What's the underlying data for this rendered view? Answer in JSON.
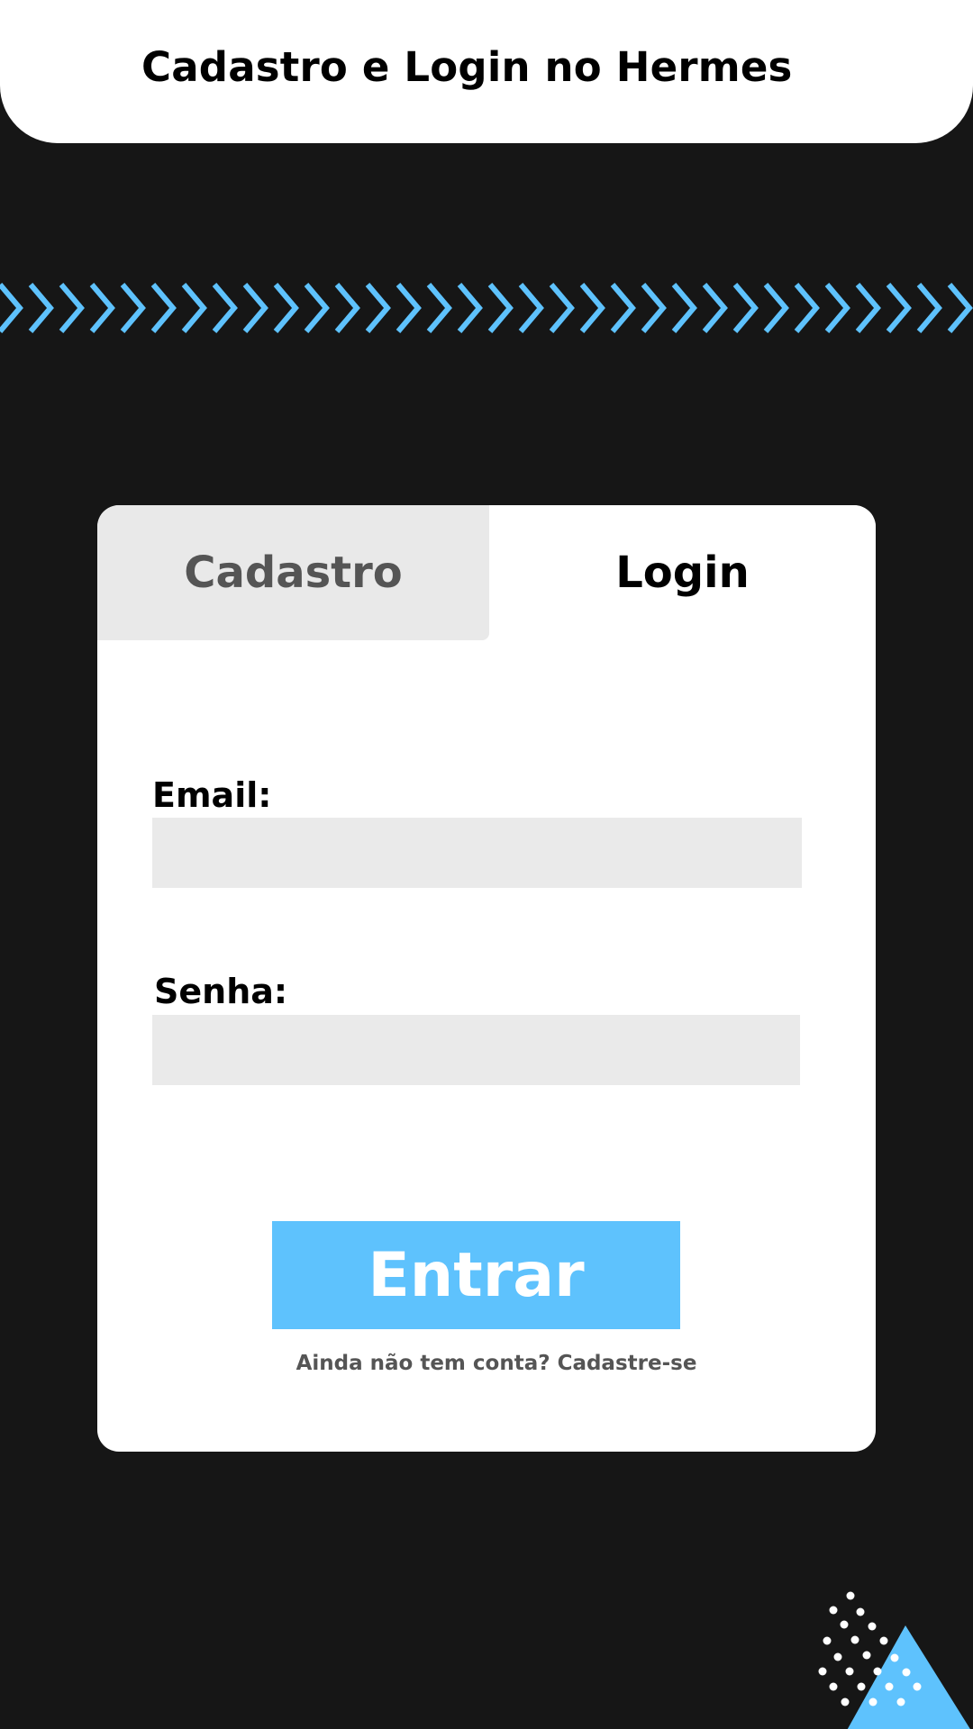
{
  "header": {
    "title": "Cadastro e Login no Hermes"
  },
  "tabs": {
    "signup_label": "Cadastro",
    "login_label": "Login",
    "active": "Login"
  },
  "form": {
    "email_label": "Email:",
    "email_value": "",
    "email_placeholder": "",
    "password_label": "Senha:",
    "password_value": "",
    "password_placeholder": ""
  },
  "actions": {
    "submit_label": "Entrar",
    "signup_prompt": "Ainda não tem conta? Cadastre-se"
  },
  "colors": {
    "background": "#161616",
    "accent": "#5ec2fd",
    "card": "#ffffff",
    "inactive_tab": "#e9e9e9",
    "input_fill": "#eaeaea",
    "muted_text": "#555555"
  },
  "icons": {
    "chevron_strip": "chevron-right-icon",
    "corner_decoration": "triangle-dots-decoration"
  }
}
